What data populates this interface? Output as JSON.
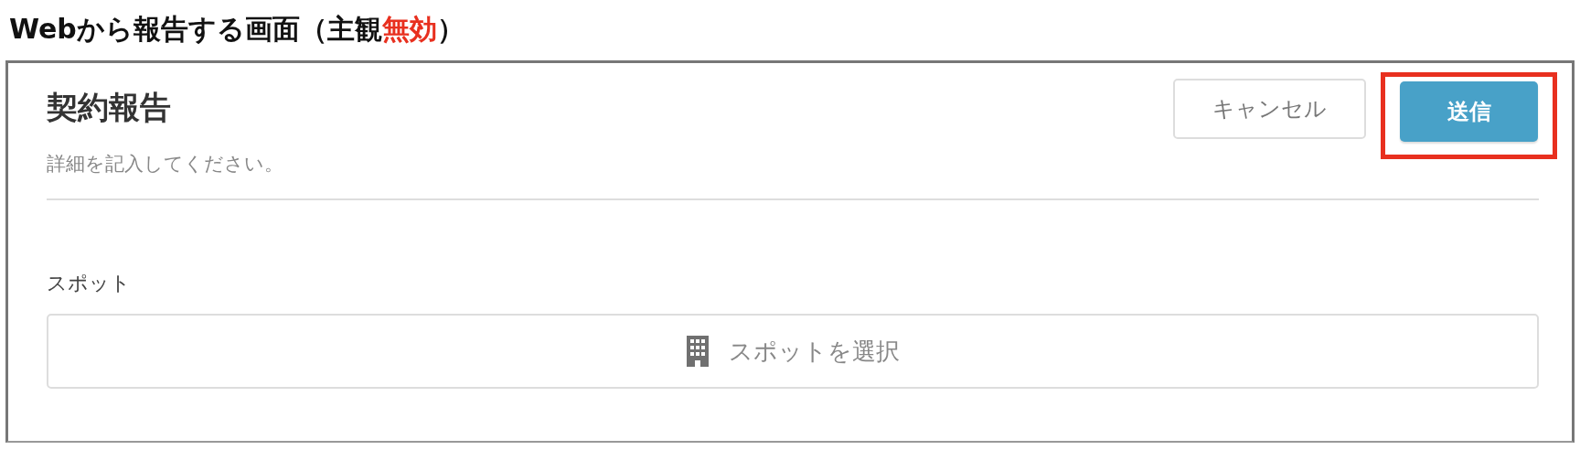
{
  "heading": [
    {
      "text": "Webから報告する画面（主観",
      "color": "#111111"
    },
    {
      "text": "無効",
      "color": "#e8301f"
    },
    {
      "text": "）",
      "color": "#111111"
    }
  ],
  "form": {
    "title": "契約報告",
    "subtitle": "詳細を記入してください。",
    "buttons": [
      {
        "label": "キャンセル",
        "kind": "secondary",
        "highlighted": false
      },
      {
        "label": "送信",
        "kind": "primary",
        "highlighted": true
      }
    ],
    "field": {
      "label": "スポット",
      "placeholder": "スポットを選択"
    }
  }
}
